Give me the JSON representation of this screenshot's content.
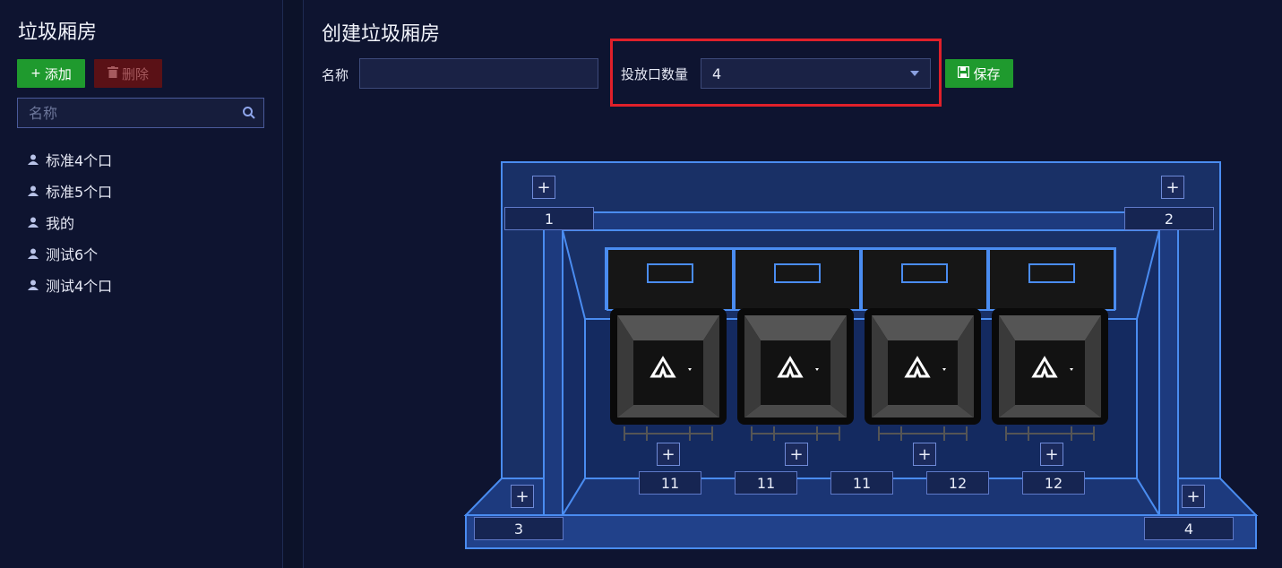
{
  "sidebar": {
    "title": "垃圾厢房",
    "add_label": "添加",
    "delete_label": "删除",
    "search_placeholder": "名称",
    "items": [
      {
        "label": "标准4个口"
      },
      {
        "label": "标准5个口"
      },
      {
        "label": "我的"
      },
      {
        "label": "测试6个"
      },
      {
        "label": "测试4个口"
      }
    ]
  },
  "main": {
    "title": "创建垃圾厢房",
    "name_label": "名称",
    "name_value": "",
    "count_label": "投放口数量",
    "count_value": "4",
    "save_label": "保存"
  },
  "room": {
    "corners": [
      "1",
      "2",
      "3",
      "4"
    ],
    "bins": [
      {
        "number": "11"
      },
      {
        "number": "11"
      },
      {
        "number": "11"
      },
      {
        "number": "12"
      },
      {
        "number": "12"
      }
    ],
    "plus_label": "+"
  },
  "colors": {
    "accent_green": "#1f9a2e",
    "danger_dark": "#5a1116",
    "highlight_red": "#e0202a",
    "outline_blue": "#4a8cf0"
  }
}
